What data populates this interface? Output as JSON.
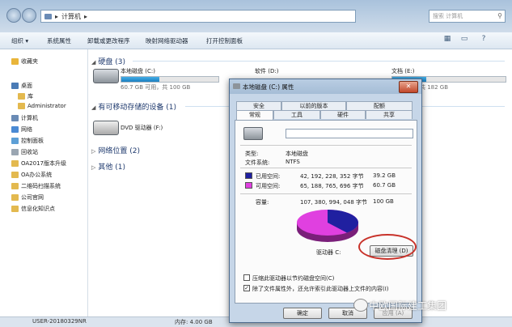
{
  "address": {
    "crumb_sep": "▸",
    "path": "计算机",
    "search_placeholder": "搜索 计算机"
  },
  "toolbar": {
    "organize": "组织 ▾",
    "system_props": "系统属性",
    "uninstall": "卸载或更改程序",
    "map_drive": "映射网络驱动器",
    "control_panel": "打开控制面板"
  },
  "navpane": {
    "items": [
      {
        "label": "收藏夹",
        "color": "#e9b53a"
      },
      {
        "label": "桌面",
        "color": "#4a7bb5"
      },
      {
        "label": "库",
        "color": "#e3b94f"
      },
      {
        "label": "Administrator",
        "color": "#e3b94f"
      },
      {
        "label": "计算机",
        "color": "#6a8bb5"
      },
      {
        "label": "网络",
        "color": "#4a8ad4"
      },
      {
        "label": "控制面板",
        "color": "#5d9fd6"
      },
      {
        "label": "回收站",
        "color": "#9aa6b2"
      },
      {
        "label": "OA2017版本升级",
        "color": "#e3b94f"
      },
      {
        "label": "OA办公系统",
        "color": "#e3b94f"
      },
      {
        "label": "二维码扫描系统",
        "color": "#e3b94f"
      },
      {
        "label": "公司官网",
        "color": "#e3b94f"
      },
      {
        "label": "信息化知识点",
        "color": "#e3b94f"
      }
    ]
  },
  "content": {
    "hdd_section": "硬盘 (3)",
    "removable_section": "有可移动存储的设备 (1)",
    "network_section": "网络位置 (2)",
    "other_section": "其他 (1)",
    "drives": [
      {
        "name": "本地磁盘 (C:)",
        "size": "60.7 GB 可用，共 100 GB",
        "fill": 0.39
      },
      {
        "name": "软件 (D:)",
        "size": "",
        "fill": 0.0
      },
      {
        "name": "文档 (E:)",
        "size": "共 182 GB",
        "fill": 0.3
      }
    ],
    "dvd": "DVD 驱动器 (F:)"
  },
  "statusbar": {
    "computer": "USER-20180329NR",
    "memory": "内存: 4.00 GB"
  },
  "dialog": {
    "title": "本地磁盘 (C:) 属性",
    "close": "✕",
    "tabs_row1": [
      "安全",
      "以前的版本",
      "配额"
    ],
    "tabs_row2": [
      "常规",
      "工具",
      "硬件",
      "共享"
    ],
    "type_label": "类型:",
    "type_value": "本地磁盘",
    "fs_label": "文件系统:",
    "fs_value": "NTFS",
    "used_label": "已用空间:",
    "used_bytes": "42, 192, 228, 352 字节",
    "used_gb": "39.2 GB",
    "free_label": "可用空间:",
    "free_bytes": "65, 188, 765, 696 字节",
    "free_gb": "60.7 GB",
    "cap_label": "容量:",
    "cap_bytes": "107, 380, 994, 048 字节",
    "cap_gb": "100 GB",
    "drive_label": "驱动器 C:",
    "cleanup": "磁盘清理 (D)",
    "compress": "压缩此驱动器以节约磁盘空间(C)",
    "index": "除了文件属性外，还允许索引此驱动器上文件的内容(I)",
    "ok": "确定",
    "cancel": "取消",
    "apply": "应用 (A)",
    "used_color": "#2020a0",
    "free_color": "#e040e0",
    "used_fraction": 0.392
  },
  "watermark": "中欧国际建工集团"
}
